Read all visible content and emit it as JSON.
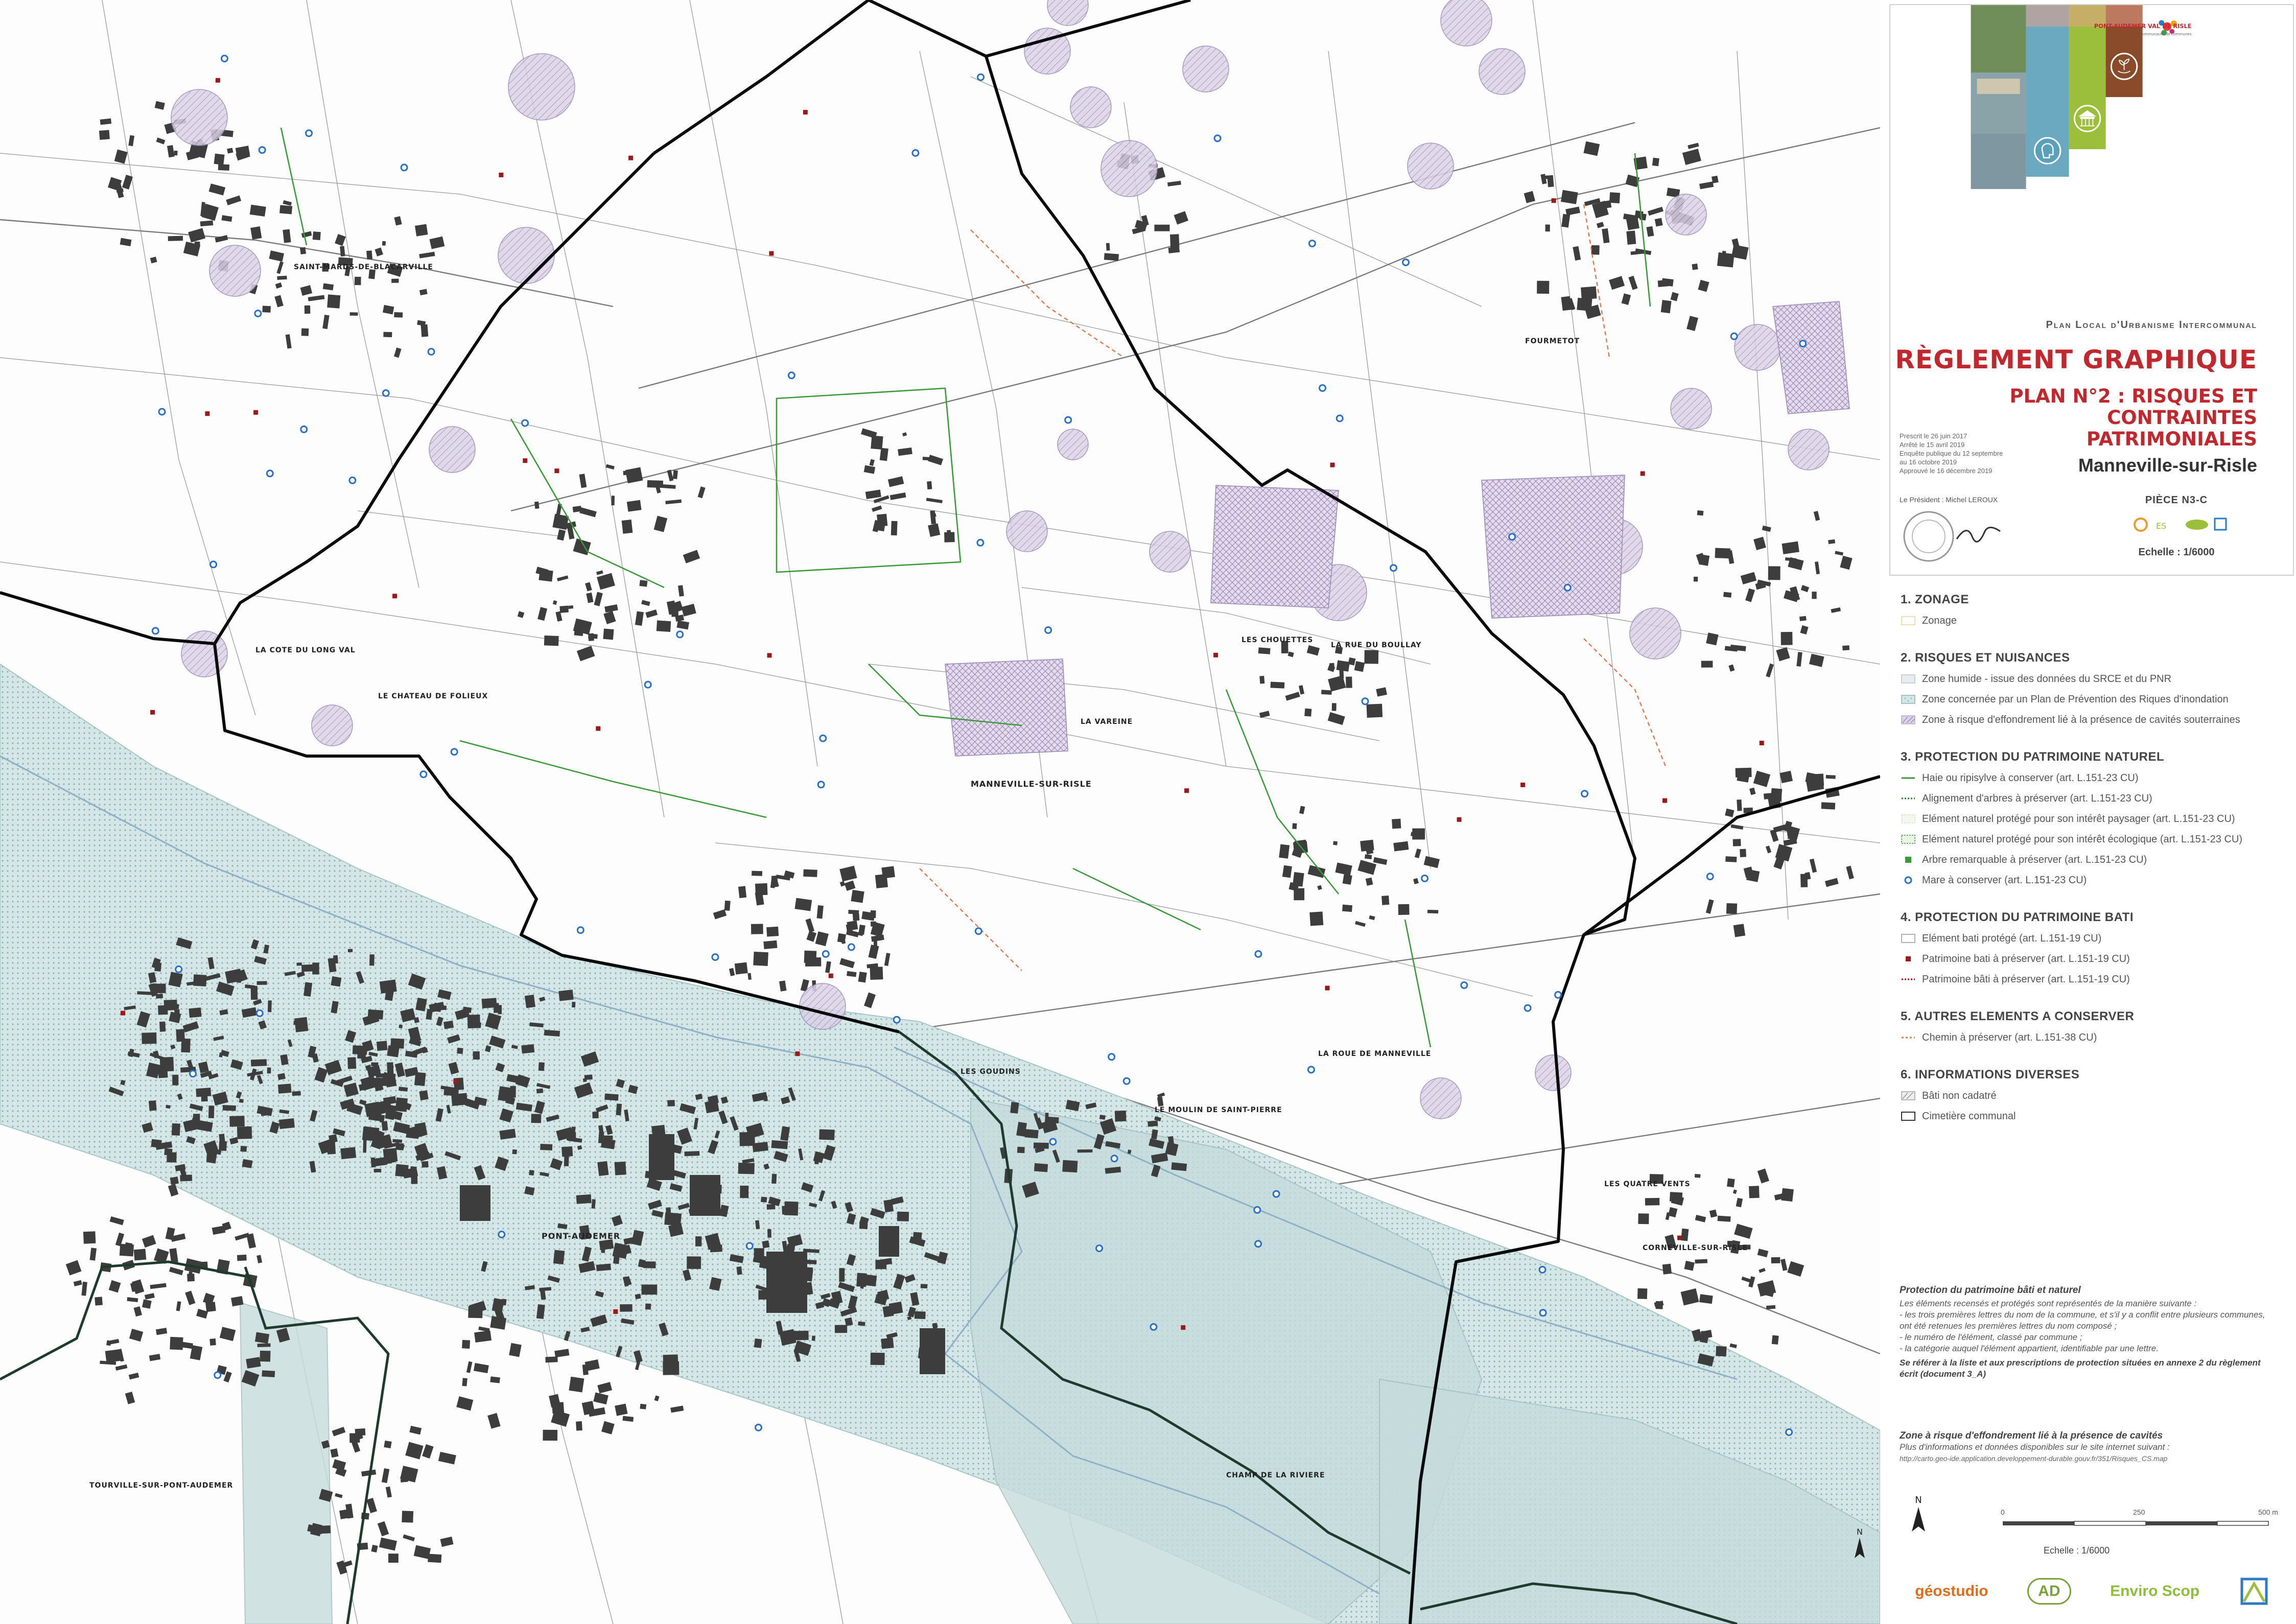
{
  "map": {
    "place_labels": [
      "SAINT-MARDS-DE-BLACARVILLE",
      "FOURMETOT",
      "MANNEVILLE-SUR-RISLE",
      "PONT-AUDEMER",
      "TOURVILLE-SUR-PONT-AUDEMER",
      "CORNEVILLE-SUR-RISLE",
      "LES GOUDINS",
      "LES CHOUETTES",
      "LA VAREINE",
      "LA ROUE DE MANNEVILLE",
      "LE MOULIN DE SAINT-PIERRE",
      "LA COTE DU LONG VAL",
      "LE CHATEAU DE FOLIEUX",
      "LES QUATRE VENTS",
      "LA RUE DU BOULLAY",
      "CHAMP DE LA RIVIERE"
    ],
    "colors": {
      "commune_boundary": "#0a0a0a",
      "flood_zone": "#bcd6d8",
      "cavity_zone": "#b7a8c8",
      "hedge": "#3a9a3a",
      "pond": "#2a6fc9",
      "heritage": "#9a1a1a",
      "building": "#3b3b3b",
      "path": "#e07850"
    },
    "north_arrow": "N"
  },
  "cartouche": {
    "brand_name": "PONT-AUDEMER VAL DE RISLE",
    "brand_sub": "communauté de communes",
    "plu_title": "Plan Local d'Urbanisme Intercommunal",
    "main_title": "RÈGLEMENT GRAPHIQUE",
    "sub_title": "PLAN N°2 : RISQUES ET CONTRAINTES PATRIMONIALES",
    "commune": "Manneville-sur-Risle",
    "dates": "Prescrit le 26 juin 2017\nArrêté le 15 avril 2019\nEnquête publique du 12 septembre\nau 16 octobre 2019\nApprouvé le 16 décembre 2019",
    "president": "Le Président : Michel LEROUX",
    "piece": "PIÈCE N3-C",
    "echelle": "Echelle : 1/6000"
  },
  "legend": {
    "sections": [
      {
        "title": "1. ZONAGE",
        "items": [
          {
            "label": "Zonage",
            "sym": "zonage"
          }
        ]
      },
      {
        "title": "2. RISQUES ET NUISANCES",
        "items": [
          {
            "label": "Zone humide - issue des données du SRCE et du PNR",
            "sym": "wet"
          },
          {
            "label": "Zone concernée par un Plan de Prévention des Riques d'inondation",
            "sym": "flood"
          },
          {
            "label": "Zone à risque d'effondrement lié à la présence de cavités souterraines",
            "sym": "cavity"
          }
        ]
      },
      {
        "title": "3. PROTECTION DU PATRIMOINE NATUREL",
        "items": [
          {
            "label": "Haie ou ripisylve à conserver (art. L.151-23 CU)",
            "sym": "hedge"
          },
          {
            "label": "Alignement d'arbres à préserver (art. L.151-23 CU)",
            "sym": "trees"
          },
          {
            "label": "Elément naturel protégé pour son intérêt paysager (art. L.151-23 CU)",
            "sym": "landscape"
          },
          {
            "label": "Elément naturel protégé pour son intérêt écologique (art. L.151-23 CU)",
            "sym": "ecologic"
          },
          {
            "label": "Arbre remarquable à préserver (art. L.151-23 CU)",
            "sym": "tree"
          },
          {
            "label": "Mare à conserver (art. L.151-23 CU)",
            "sym": "pond"
          }
        ]
      },
      {
        "title": "4. PROTECTION DU PATRIMOINE BATI",
        "items": [
          {
            "label": "Elément bati protégé (art. L.151-19 CU)",
            "sym": "bati"
          },
          {
            "label": "Patrimoine bati à préserver (art. L.151-19 CU)",
            "sym": "heritage-point"
          },
          {
            "label": "Patrimoine bâti à préserver (art. L.151-19 CU)",
            "sym": "heritage-line"
          }
        ]
      },
      {
        "title": "5. AUTRES ELEMENTS A CONSERVER",
        "items": [
          {
            "label": "Chemin à préserver  (art. L.151-38 CU)",
            "sym": "path"
          }
        ]
      },
      {
        "title": "6. INFORMATIONS DIVERSES",
        "items": [
          {
            "label": "Bâti non cadatré",
            "sym": "noncad"
          },
          {
            "label": "Cimetière communal",
            "sym": "cemetery"
          }
        ]
      }
    ]
  },
  "notes": {
    "title": "Protection du patrimoine bâti et naturel",
    "body": "Les éléments recensés et protégés sont représentés de la manière suivante :\n - les trois premières lettres du nom de la commune, et s'il y a conflit entre plusieurs communes,\n   ont été retenues les premières lettres du nom composé ;\n - le numéro de l'élément, classé par commune ;\n - la catégorie auquel l'élément appartient, identifiable par une lettre.",
    "ref": "Se référer à la liste et aux prescriptions de protection situées en annexe 2 du règlement écrit (document 3_A)"
  },
  "cavities": {
    "title": "Zone à risque d'effondrement lié à la présence de cavités",
    "body": "Plus d'informations et données disponibles sur le site internet suivant :",
    "url": "http://carto.geo-ide.application.developpement-durable.gouv.fr/351/Risques_CS.map"
  },
  "scale": {
    "ticks": [
      "0",
      "250",
      "500 m"
    ],
    "echelle": "Echelle : 1/6000",
    "north": "N"
  },
  "logos": [
    "géostudio",
    "AD",
    "Enviro Scop"
  ]
}
